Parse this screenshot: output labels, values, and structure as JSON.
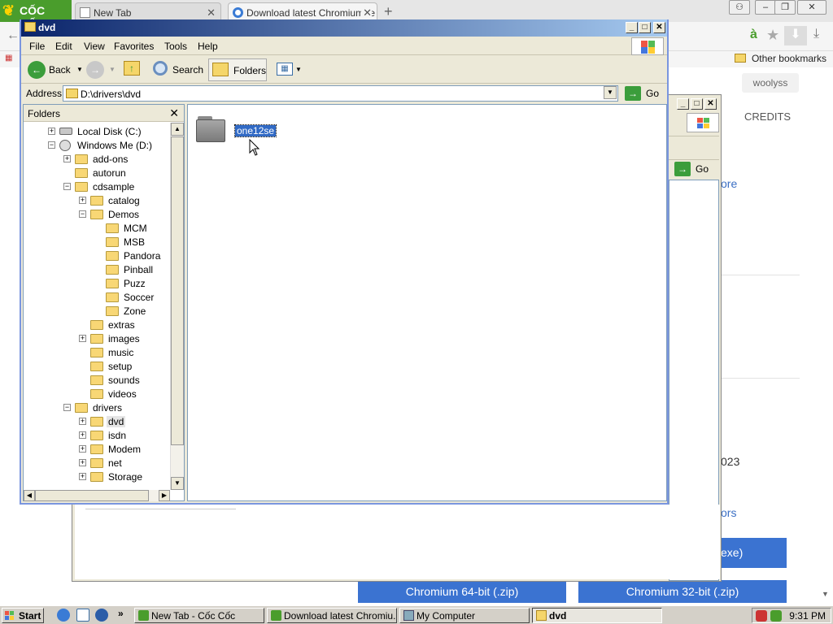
{
  "browser": {
    "logo_text": "CỐC CỐC",
    "tabs": [
      {
        "label": "New Tab"
      },
      {
        "label": "Download latest Chromium re"
      }
    ],
    "other_bookmarks": "Other bookmarks",
    "page": {
      "user": "woolyss",
      "credits": "CREDITS",
      "more": "ore",
      "year": "023",
      "errors": "ors",
      "exe_btn": "exe)",
      "dl64": "Chromium 64-bit (.zip)",
      "dl32": "Chromium 32-bit (.zip)"
    }
  },
  "bg_window": {
    "go": "Go"
  },
  "explorer": {
    "title": "dvd",
    "menu": [
      "File",
      "Edit",
      "View",
      "Favorites",
      "Tools",
      "Help"
    ],
    "toolbar": {
      "back": "Back",
      "search": "Search",
      "folders": "Folders"
    },
    "address": {
      "label": "Address",
      "value": "D:\\drivers\\dvd",
      "go": "Go"
    },
    "folders_pane": {
      "title": "Folders",
      "items": [
        {
          "label": "Local Disk (C:)",
          "exp": "+",
          "icon": "drive"
        },
        {
          "label": "Windows Me (D:)",
          "exp": "-",
          "icon": "cd"
        },
        {
          "label": "add-ons",
          "exp": "+",
          "icon": "folder"
        },
        {
          "label": "autorun",
          "exp": "",
          "icon": "folder"
        },
        {
          "label": "cdsample",
          "exp": "-",
          "icon": "folder"
        },
        {
          "label": "catalog",
          "exp": "+",
          "icon": "folder"
        },
        {
          "label": "Demos",
          "exp": "-",
          "icon": "folder"
        },
        {
          "label": "MCM",
          "exp": "",
          "icon": "folder"
        },
        {
          "label": "MSB",
          "exp": "",
          "icon": "folder"
        },
        {
          "label": "Pandora",
          "exp": "",
          "icon": "folder"
        },
        {
          "label": "Pinball",
          "exp": "",
          "icon": "folder"
        },
        {
          "label": "Puzz",
          "exp": "",
          "icon": "folder"
        },
        {
          "label": "Soccer",
          "exp": "",
          "icon": "folder"
        },
        {
          "label": "Zone",
          "exp": "",
          "icon": "folder"
        },
        {
          "label": "extras",
          "exp": "",
          "icon": "folder"
        },
        {
          "label": "images",
          "exp": "+",
          "icon": "folder"
        },
        {
          "label": "music",
          "exp": "",
          "icon": "folder"
        },
        {
          "label": "setup",
          "exp": "",
          "icon": "folder"
        },
        {
          "label": "sounds",
          "exp": "",
          "icon": "folder"
        },
        {
          "label": "videos",
          "exp": "",
          "icon": "folder"
        },
        {
          "label": "drivers",
          "exp": "-",
          "icon": "folder"
        },
        {
          "label": "dvd",
          "exp": "+",
          "icon": "folder"
        },
        {
          "label": "isdn",
          "exp": "+",
          "icon": "folder"
        },
        {
          "label": "Modem",
          "exp": "+",
          "icon": "folder"
        },
        {
          "label": "net",
          "exp": "+",
          "icon": "folder"
        },
        {
          "label": "Storage",
          "exp": "+",
          "icon": "folder"
        }
      ]
    },
    "content": {
      "file_name": "one12se"
    }
  },
  "taskbar": {
    "start": "Start",
    "quick_launch_more": "»",
    "tasks": [
      {
        "label": "New Tab - Cốc Cốc"
      },
      {
        "label": "Download latest Chromiu..."
      },
      {
        "label": "My Computer"
      },
      {
        "label": "dvd"
      }
    ],
    "clock": "9:31 PM"
  },
  "colors": {
    "title_gradient_start": "#0a246a",
    "title_gradient_end": "#a6caf0",
    "selection": "#316ac5",
    "button_blue": "#3b73d1",
    "coc_green": "#4a9d2c"
  }
}
